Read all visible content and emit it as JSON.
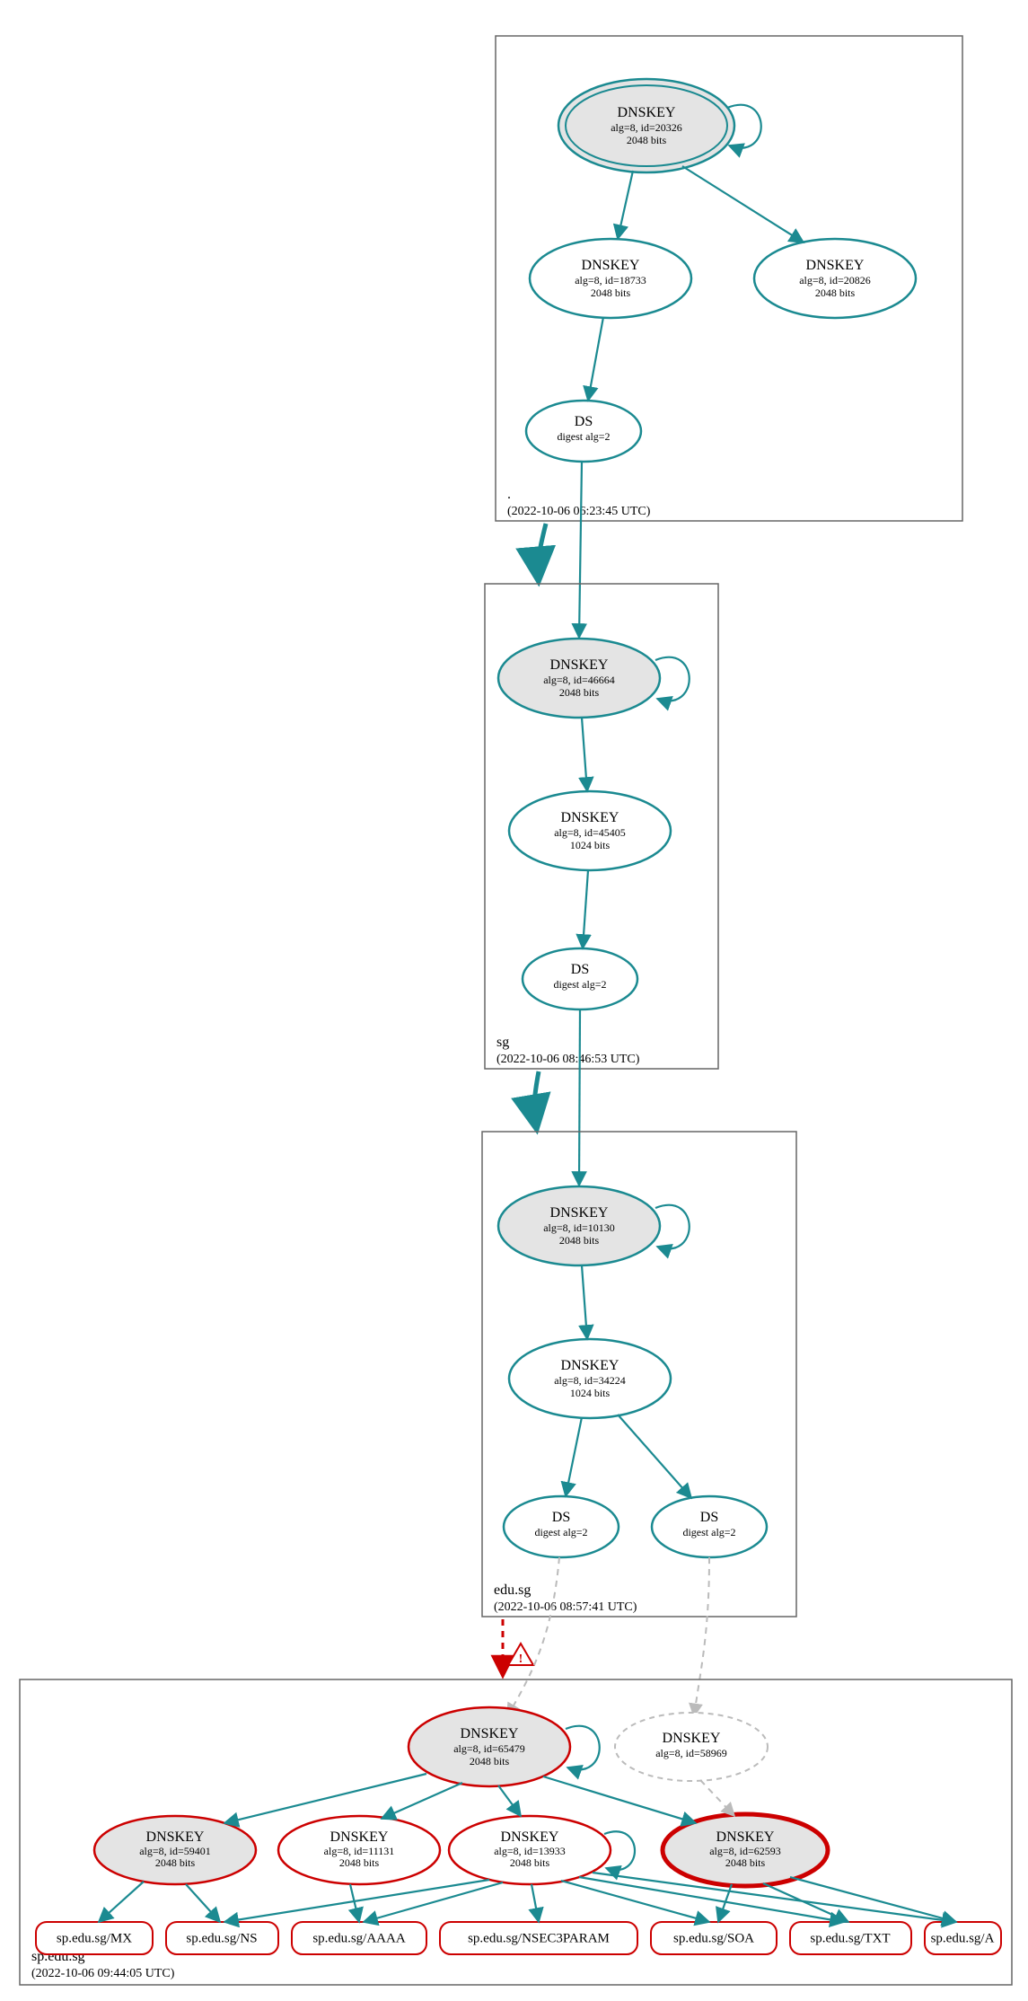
{
  "chart_data": {
    "type": "diagram",
    "description": "DNSSEC delegation / authentication chain for sp.edu.sg",
    "zones": [
      {
        "name": ".",
        "timestamp": "(2022-10-06 06:23:45 UTC)"
      },
      {
        "name": "sg",
        "timestamp": "(2022-10-06 08:46:53 UTC)"
      },
      {
        "name": "edu.sg",
        "timestamp": "(2022-10-06 08:57:41 UTC)"
      },
      {
        "name": "sp.edu.sg",
        "timestamp": "(2022-10-06 09:44:05 UTC)"
      }
    ],
    "nodes": {
      "root_ksk": {
        "title": "DNSKEY",
        "line2": "alg=8, id=20326",
        "line3": "2048 bits"
      },
      "root_zsk1": {
        "title": "DNSKEY",
        "line2": "alg=8, id=18733",
        "line3": "2048 bits"
      },
      "root_zsk2": {
        "title": "DNSKEY",
        "line2": "alg=8, id=20826",
        "line3": "2048 bits"
      },
      "root_ds": {
        "title": "DS",
        "line2": "digest alg=2"
      },
      "sg_ksk": {
        "title": "DNSKEY",
        "line2": "alg=8, id=46664",
        "line3": "2048 bits"
      },
      "sg_zsk": {
        "title": "DNSKEY",
        "line2": "alg=8, id=45405",
        "line3": "1024 bits"
      },
      "sg_ds": {
        "title": "DS",
        "line2": "digest alg=2"
      },
      "edu_ksk": {
        "title": "DNSKEY",
        "line2": "alg=8, id=10130",
        "line3": "2048 bits"
      },
      "edu_zsk": {
        "title": "DNSKEY",
        "line2": "alg=8, id=34224",
        "line3": "1024 bits"
      },
      "edu_ds1": {
        "title": "DS",
        "line2": "digest alg=2"
      },
      "edu_ds2": {
        "title": "DS",
        "line2": "digest alg=2"
      },
      "sp_ksk": {
        "title": "DNSKEY",
        "line2": "alg=8, id=65479",
        "line3": "2048 bits"
      },
      "sp_ghost": {
        "title": "DNSKEY",
        "line2": "alg=8, id=58969"
      },
      "sp_k1": {
        "title": "DNSKEY",
        "line2": "alg=8, id=59401",
        "line3": "2048 bits"
      },
      "sp_k2": {
        "title": "DNSKEY",
        "line2": "alg=8, id=11131",
        "line3": "2048 bits"
      },
      "sp_k3": {
        "title": "DNSKEY",
        "line2": "alg=8, id=13933",
        "line3": "2048 bits"
      },
      "sp_k4": {
        "title": "DNSKEY",
        "line2": "alg=8, id=62593",
        "line3": "2048 bits"
      }
    },
    "rrsets": [
      "sp.edu.sg/MX",
      "sp.edu.sg/NS",
      "sp.edu.sg/AAAA",
      "sp.edu.sg/NSEC3PARAM",
      "sp.edu.sg/SOA",
      "sp.edu.sg/TXT",
      "sp.edu.sg/A"
    ],
    "edges_note": "Solid teal = secure; thick teal to zone box = delegation; dashed red with warning = bogus/insecure; dashed grey = unresolved/extra DS→DNSKEY."
  }
}
